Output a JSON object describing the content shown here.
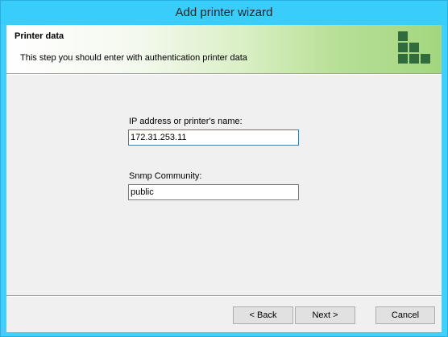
{
  "window": {
    "title": "Add printer wizard"
  },
  "header": {
    "title": "Printer data",
    "description": "This step you should enter with authentication printer data"
  },
  "form": {
    "ip_label": "IP address or printer's name:",
    "ip_value": "172.31.253.11",
    "snmp_label": "Snmp Community:",
    "snmp_value": "public"
  },
  "buttons": {
    "back": "< Back",
    "next": "Next >",
    "cancel": "Cancel"
  },
  "colors": {
    "titlebar": "#39cdfc",
    "logo": "#2f6b3c",
    "header_gradient_end": "#a3d67f"
  },
  "icons": {
    "logo": "stacked-squares-logo-icon"
  }
}
